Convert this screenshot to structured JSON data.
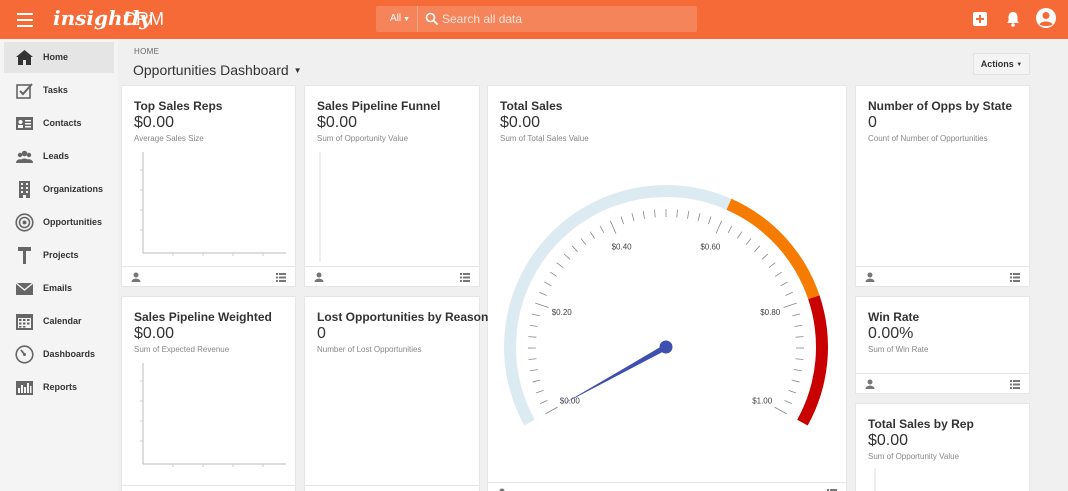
{
  "app": {
    "logo": "insightly",
    "product": "CRM"
  },
  "search": {
    "scope": "All",
    "placeholder": "Search all data"
  },
  "sidebar": {
    "items": [
      {
        "label": "Home",
        "icon": "home-icon"
      },
      {
        "label": "Tasks",
        "icon": "tasks-checkbox-icon"
      },
      {
        "label": "Contacts",
        "icon": "contact-card-icon"
      },
      {
        "label": "Leads",
        "icon": "people-icon"
      },
      {
        "label": "Organizations",
        "icon": "building-icon"
      },
      {
        "label": "Opportunities",
        "icon": "target-icon"
      },
      {
        "label": "Projects",
        "icon": "hammer-icon"
      },
      {
        "label": "Emails",
        "icon": "envelope-icon"
      },
      {
        "label": "Calendar",
        "icon": "calendar-icon"
      },
      {
        "label": "Dashboards",
        "icon": "dashboard-gauge-icon"
      },
      {
        "label": "Reports",
        "icon": "bar-chart-icon"
      }
    ]
  },
  "header": {
    "breadcrumb": "HOME",
    "title": "Opportunities Dashboard",
    "actions_label": "Actions"
  },
  "cards": {
    "top_sales_reps": {
      "title": "Top Sales Reps",
      "value": "$0.00",
      "sub": "Average Sales Size"
    },
    "pipeline_funnel": {
      "title": "Sales Pipeline Funnel",
      "value": "$0.00",
      "sub": "Sum of Opportunity Value"
    },
    "total_sales": {
      "title": "Total Sales",
      "value": "$0.00",
      "sub": "Sum of Total Sales Value"
    },
    "opps_by_state": {
      "title": "Number of Opps by State",
      "value": "0",
      "sub": "Count of Number of Opportunities"
    },
    "pipeline_weighted": {
      "title": "Sales Pipeline Weighted",
      "value": "$0.00",
      "sub": "Sum of Expected Revenue"
    },
    "lost_opps": {
      "title": "Lost Opportunities by Reason",
      "value": "0",
      "sub": "Number of Lost Opportunities"
    },
    "win_rate": {
      "title": "Win Rate",
      "value": "0.00%",
      "sub": "Sum of Win Rate"
    },
    "total_sales_by_rep": {
      "title": "Total Sales by Rep",
      "value": "$0.00",
      "sub": "Sum of Opportunity Value"
    }
  },
  "gauge": {
    "min": 0,
    "max": 1,
    "value": 0,
    "labels": [
      {
        "value": 0,
        "text": "$0.00"
      },
      {
        "value": 0.2,
        "text": "$0.20"
      },
      {
        "value": 0.4,
        "text": "$0.40"
      },
      {
        "value": 0.6,
        "text": "$0.60"
      },
      {
        "value": 0.8,
        "text": "$0.80"
      },
      {
        "value": 1,
        "text": "$1.00"
      }
    ],
    "bands": [
      {
        "from": 0,
        "to": 0.6,
        "color": "#dcebf2"
      },
      {
        "from": 0.6,
        "to": 0.8,
        "color": "#f57c00"
      },
      {
        "from": 0.8,
        "to": 1,
        "color": "#c80000"
      }
    ],
    "needle_color": "#3f4fb0"
  },
  "colors": {
    "brand": "#f56a37",
    "band_low": "#dcebf2",
    "band_mid": "#f57c00",
    "band_high": "#c80000",
    "needle": "#3f4fb0"
  }
}
